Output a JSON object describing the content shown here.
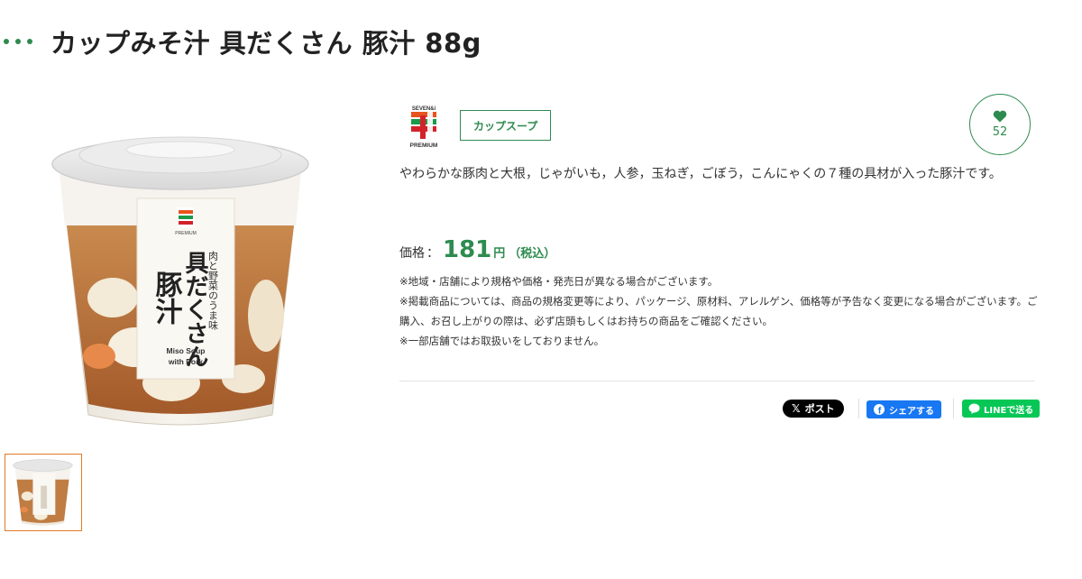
{
  "product": {
    "title": "カップみそ汁 具だくさん 豚汁 88g",
    "category": "カップスープ",
    "favorite_count": "52",
    "description": "やわらかな豚肉と大根，じゃがいも，人参，玉ねぎ，ごぼう，こんにゃくの７種の具材が入った豚汁です。",
    "price_label": "価格",
    "price_value": "181",
    "price_unit": "円",
    "price_tax": "（税込）",
    "notes": [
      "※地域・店舗により規格や価格・発売日が異なる場合がございます。",
      "※掲載商品については、商品の規格変更等により、パッケージ、原材料、アレルゲン、価格等が予告なく変更になる場合がございます。ご購入、お召し上がりの際は、必ず店頭もしくはお持ちの商品をご確認ください。",
      "※一部店舗ではお取扱いをしておりません。"
    ]
  },
  "brand": {
    "logo_text_top": "SEVEN&i",
    "logo_text_bottom": "PREMIUM"
  },
  "package": {
    "tagline": "肉と野菜のうま味",
    "name_line1": "具だくさん",
    "name_line2": "豚汁",
    "english": "Miso Soup with Pork"
  },
  "share": {
    "x_label": "ポスト",
    "facebook_label": "シェアする",
    "line_label": "LINEで送る"
  },
  "colors": {
    "accent_green": "#2e8b4f",
    "thumb_border": "#e07b2a",
    "x_black": "#000000",
    "facebook_blue": "#1877f2",
    "line_green": "#06c755"
  }
}
